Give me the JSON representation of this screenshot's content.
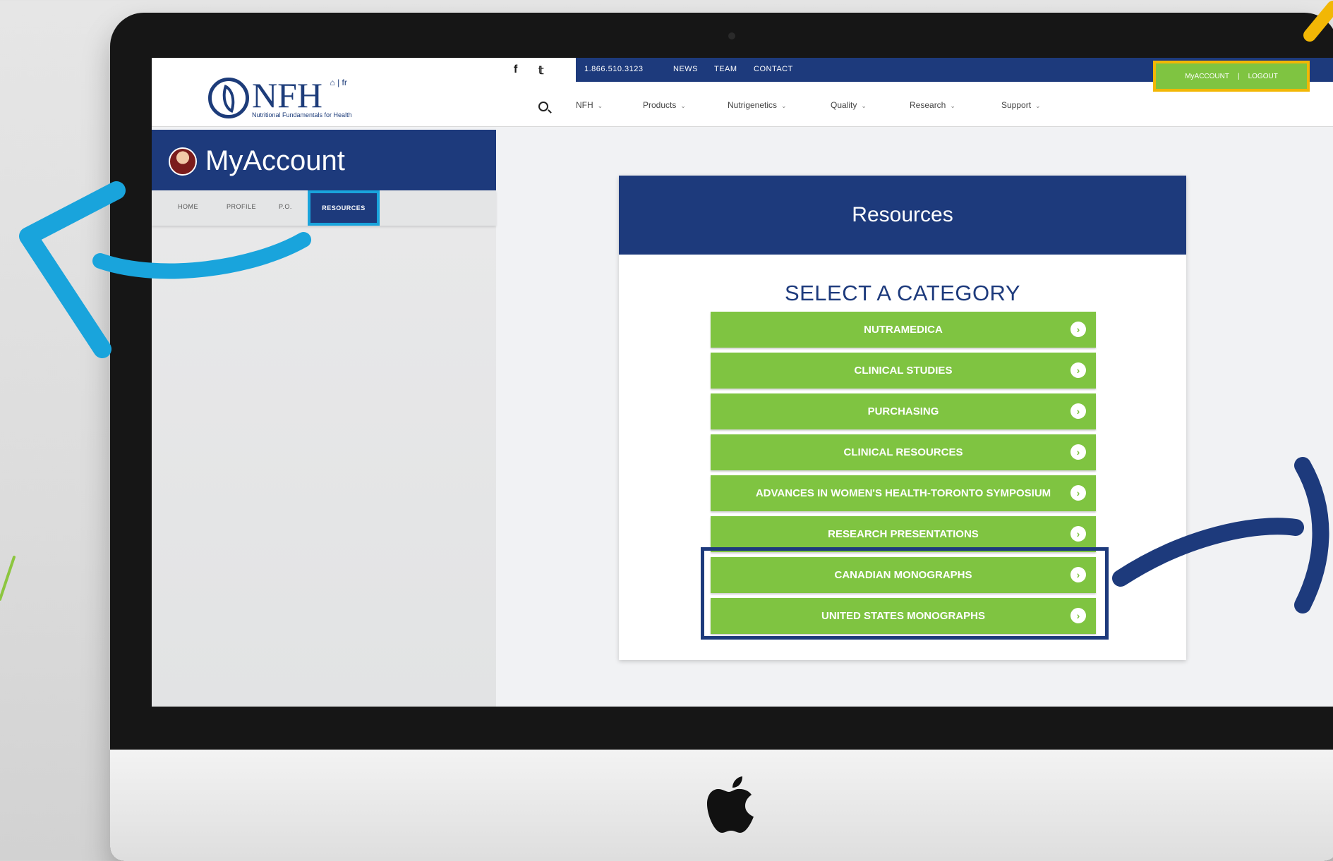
{
  "header": {
    "logo_text": "NFH",
    "logo_lang": "⌂ | fr",
    "logo_subtitle": "Nutritional Fundamentals for Health",
    "social": [
      "f",
      "𝕥"
    ],
    "phone": "1.866.510.3123",
    "utility_links": [
      "NEWS",
      "TEAM",
      "CONTACT"
    ],
    "account_link": "MyACCOUNT",
    "account_separator": "|",
    "logout_link": "LOGOUT",
    "nav_items": [
      "NFH",
      "Products",
      "Nutrigenetics",
      "Quality",
      "Research",
      "Support"
    ]
  },
  "sidebar": {
    "title": "MyAccount",
    "tabs": [
      "HOME",
      "PROFILE",
      "P.O.",
      "RESOURCES"
    ],
    "active_tab": "RESOURCES"
  },
  "resources": {
    "title": "Resources",
    "subtitle": "SELECT A CATEGORY",
    "categories": [
      "NUTRAMEDICA",
      "CLINICAL STUDIES",
      "PURCHASING",
      "CLINICAL RESOURCES",
      "ADVANCES IN WOMEN'S HEALTH-TORONTO SYMPOSIUM",
      "RESEARCH PRESENTATIONS",
      "CANADIAN MONOGRAPHS",
      "UNITED STATES MONOGRAPHS"
    ]
  },
  "colors": {
    "brand_blue": "#1d3a7c",
    "action_green": "#7fc441",
    "highlight_cyan": "#19a4dc",
    "highlight_yellow": "#f2b705"
  }
}
